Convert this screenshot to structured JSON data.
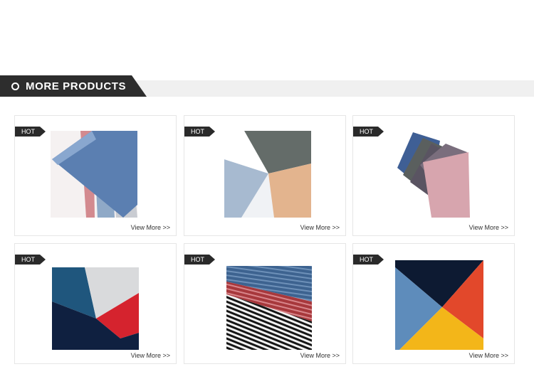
{
  "section": {
    "title": "MORE PRODUCTS"
  },
  "products": [
    {
      "badge": "HOT",
      "link_label": "View More >>"
    },
    {
      "badge": "HOT",
      "link_label": "View More >>"
    },
    {
      "badge": "HOT",
      "link_label": "View More >>"
    },
    {
      "badge": "HOT",
      "link_label": "View More >>"
    },
    {
      "badge": "HOT",
      "link_label": "View More >>"
    },
    {
      "badge": "HOT",
      "link_label": "View More >>"
    }
  ],
  "colors": {
    "title_bg": "#2d2d2d",
    "section_bar": "#f0f0f0",
    "badge_bg": "#2a2a2a",
    "card_border": "#e6e6e6"
  }
}
